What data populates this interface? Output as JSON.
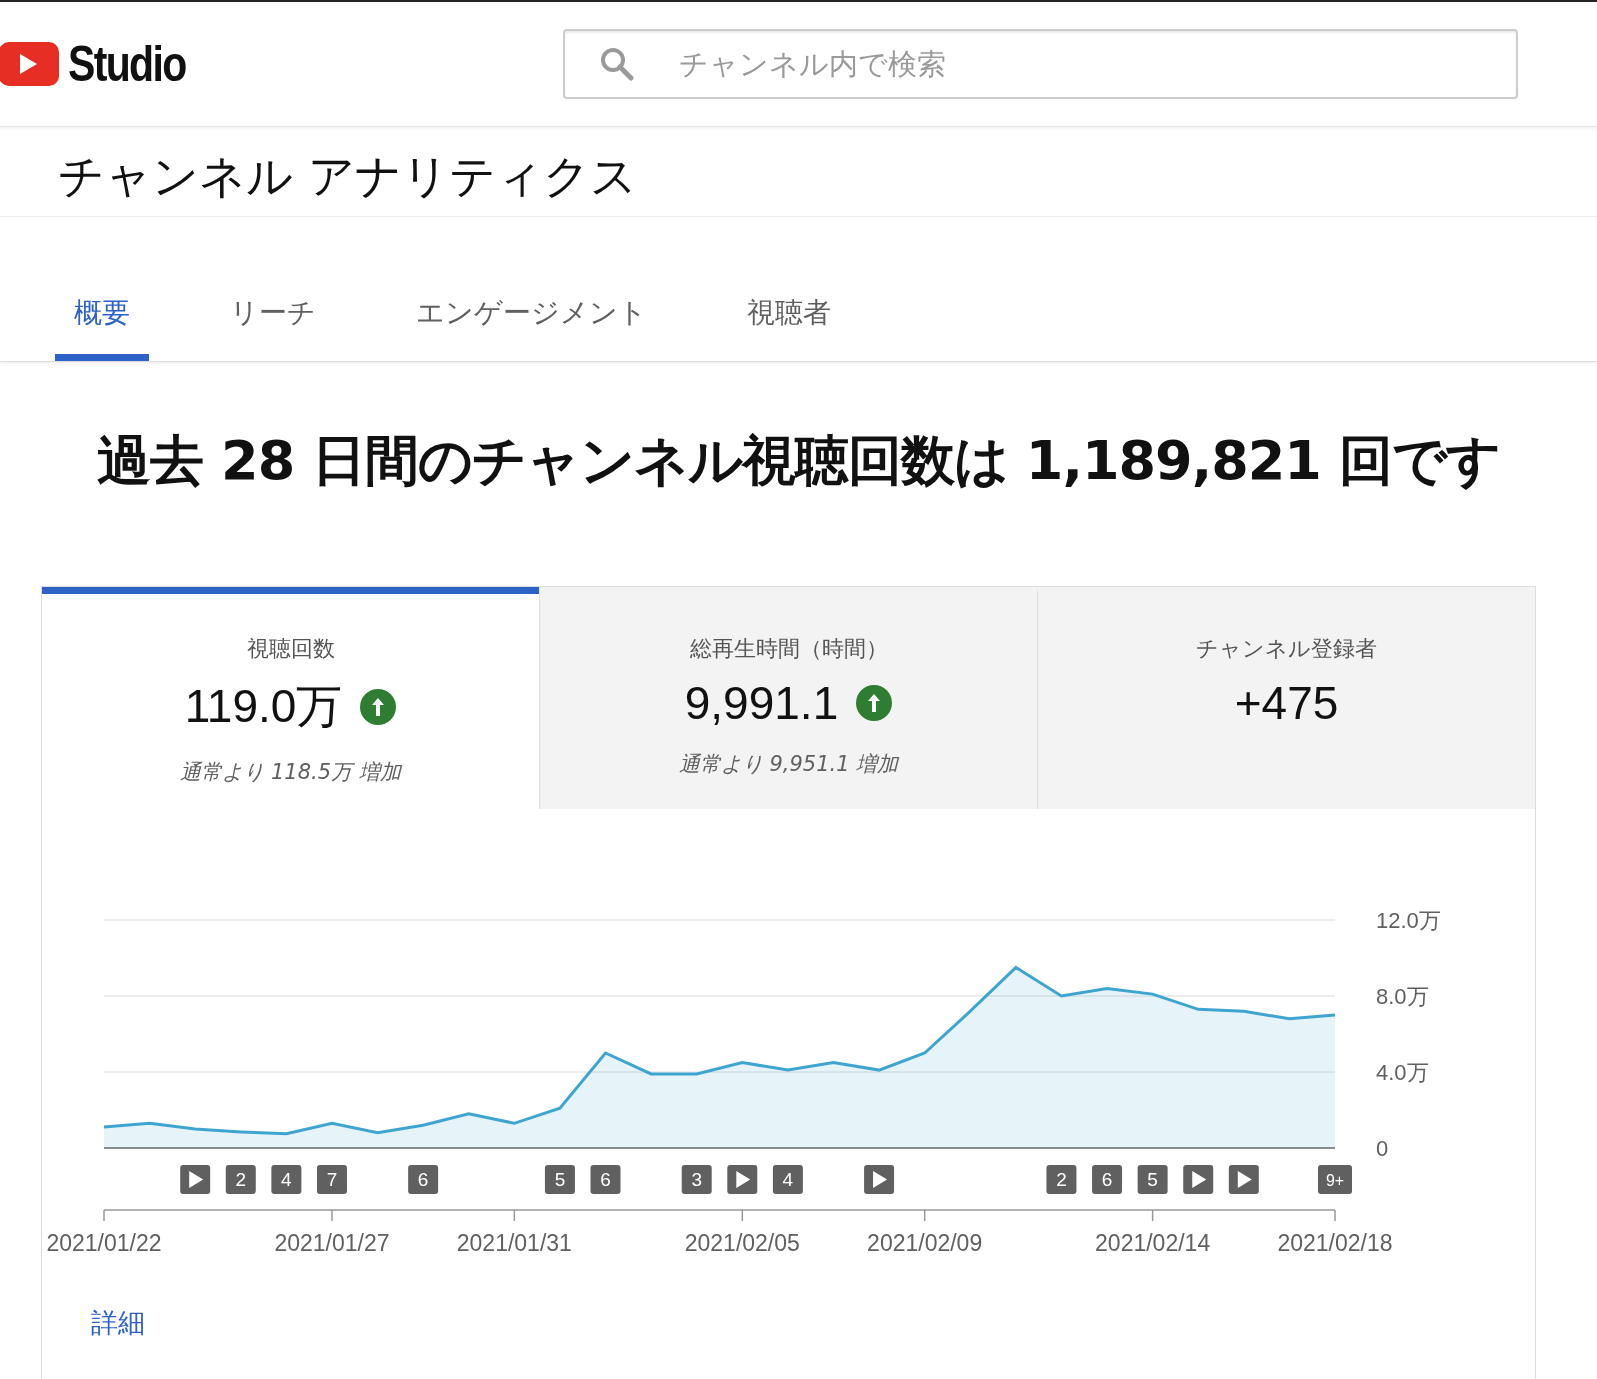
{
  "header": {
    "logo_text": "Studio",
    "search": {
      "placeholder": "チャンネル内で検索"
    }
  },
  "page_title": "チャンネル アナリティクス",
  "tabs": [
    {
      "label": "概要",
      "selected": true
    },
    {
      "label": "リーチ",
      "selected": false
    },
    {
      "label": "エンゲージメント",
      "selected": false
    },
    {
      "label": "視聴者",
      "selected": false
    }
  ],
  "headline": "過去 28 日間のチャンネル視聴回数は 1,189,821 回です",
  "metric_cards": [
    {
      "label": "視聴回数",
      "value": "119.0万",
      "rising": true,
      "note": "通常より 118.5万 増加",
      "selected": true
    },
    {
      "label": "総再生時間（時間）",
      "value": "9,991.1",
      "rising": true,
      "note": "通常より 9,951.1 増加",
      "selected": false
    },
    {
      "label": "チャンネル登録者",
      "value": "+475",
      "rising": false,
      "selected": false
    }
  ],
  "chart_data": {
    "type": "area",
    "categories": [
      "2021/01/22",
      null,
      null,
      null,
      null,
      "2021/01/27",
      null,
      null,
      null,
      "2021/01/31",
      null,
      null,
      null,
      null,
      "2021/02/05",
      null,
      null,
      null,
      "2021/02/09",
      null,
      null,
      null,
      null,
      "2021/02/14",
      null,
      null,
      null,
      "2021/02/18"
    ],
    "series": [
      {
        "color": "#3ea5d1",
        "values": [
          1.1,
          1.3,
          1.0,
          0.85,
          0.75,
          1.3,
          0.8,
          1.2,
          1.8,
          1.3,
          2.1,
          5.0,
          3.9,
          3.9,
          4.5,
          4.1,
          4.5,
          4.1,
          5.0,
          7.2,
          9.5,
          8.0,
          8.4,
          8.1,
          7.3,
          7.2,
          6.8,
          7.0
        ]
      }
    ],
    "ylim": [
      0,
      12
    ],
    "yticks": [
      {
        "value": 0,
        "label": "0"
      },
      {
        "value": 4,
        "label": "4.0万"
      },
      {
        "value": 8,
        "label": "8.0万"
      },
      {
        "value": 12,
        "label": "12.0万"
      }
    ]
  },
  "video_markers": [
    {
      "kind": "none"
    },
    {
      "kind": "none"
    },
    {
      "kind": "play"
    },
    {
      "kind": "count",
      "text": "2"
    },
    {
      "kind": "count",
      "text": "4"
    },
    {
      "kind": "count",
      "text": "7"
    },
    {
      "kind": "none"
    },
    {
      "kind": "count",
      "text": "6"
    },
    {
      "kind": "none"
    },
    {
      "kind": "none"
    },
    {
      "kind": "count",
      "text": "5"
    },
    {
      "kind": "count",
      "text": "6"
    },
    {
      "kind": "none"
    },
    {
      "kind": "count",
      "text": "3"
    },
    {
      "kind": "play"
    },
    {
      "kind": "count",
      "text": "4"
    },
    {
      "kind": "none"
    },
    {
      "kind": "play"
    },
    {
      "kind": "none"
    },
    {
      "kind": "none"
    },
    {
      "kind": "none"
    },
    {
      "kind": "count",
      "text": "2"
    },
    {
      "kind": "count",
      "text": "6"
    },
    {
      "kind": "count",
      "text": "5"
    },
    {
      "kind": "play"
    },
    {
      "kind": "play"
    },
    {
      "kind": "none"
    },
    {
      "kind": "count",
      "text": "9+"
    }
  ],
  "more_link": "詳細"
}
